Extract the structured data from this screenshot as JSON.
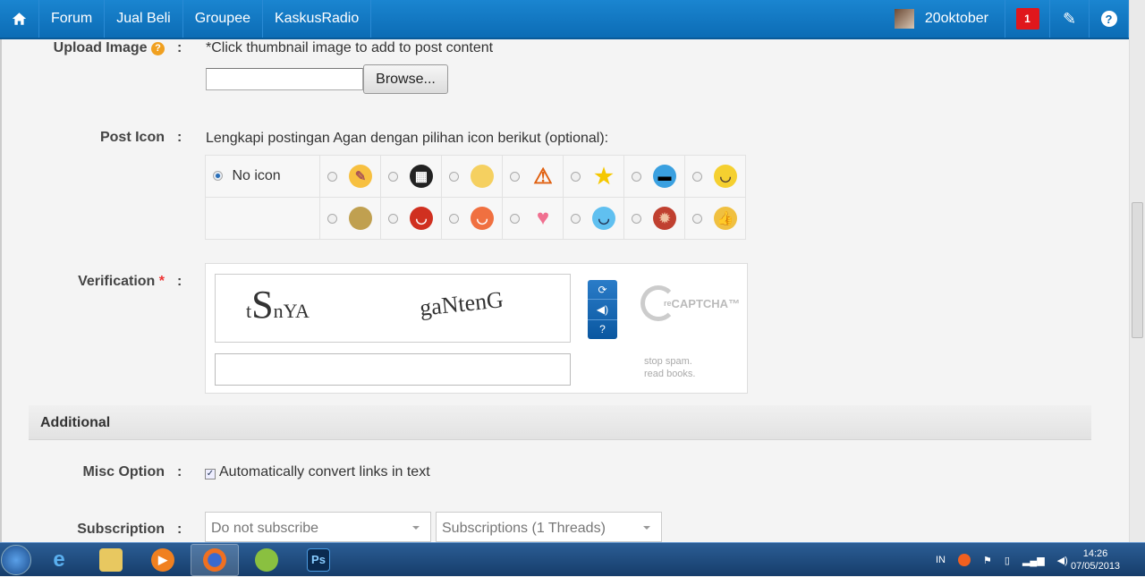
{
  "nav": {
    "items": [
      "Forum",
      "Jual Beli",
      "Groupee",
      "KaskusRadio"
    ],
    "username": "20oktober",
    "notification_count": "1"
  },
  "form": {
    "upload": {
      "label": "Upload Image",
      "help": "?",
      "hint": "*Click thumbnail image to add to post content",
      "browse": "Browse..."
    },
    "post_icon": {
      "label": "Post Icon",
      "hint": "Lengkapi postingan Agan dengan pilihan icon berikut (optional):",
      "no_icon": "No icon",
      "selected": "No icon",
      "icons": [
        [
          "pencil",
          "clapperboard",
          "lightbulb",
          "warning",
          "star",
          "cool-face",
          "grin-face"
        ],
        [
          "poop",
          "angry-face",
          "laugh-face",
          "heart",
          "happy-blue-face",
          "spiky-face",
          "thumbs-up"
        ]
      ]
    },
    "verification": {
      "label": "Verification",
      "required": "*",
      "captcha_words": [
        "t",
        "S",
        "nYA",
        "gaNtenG"
      ],
      "brand": "reCAPTCHA™",
      "brand_re": "re",
      "brand_main": "CAPTCHA™",
      "tagline1": "stop spam.",
      "tagline2": "read books."
    },
    "additional": {
      "title": "Additional"
    },
    "misc": {
      "label": "Misc Option",
      "checkbox": "Automatically convert links in text",
      "checked": true
    },
    "subscription": {
      "label": "Subscription",
      "mode": "Do not subscribe",
      "folder": "Subscriptions (1 Threads)"
    }
  },
  "colon": ":",
  "taskbar": {
    "lang": "IN",
    "time": "14:26",
    "date": "07/05/2013",
    "ps": "Ps"
  },
  "colors": {
    "nav": "#0c6cb5",
    "badge": "#e0171c"
  }
}
